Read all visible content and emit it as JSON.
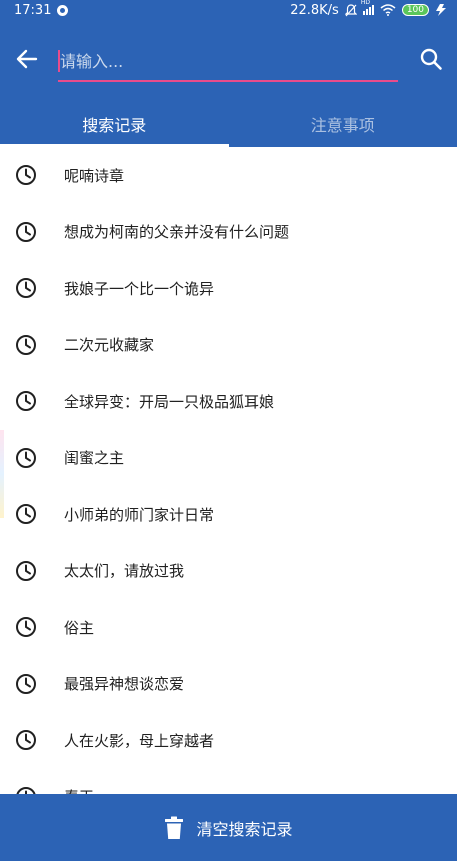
{
  "status_bar": {
    "time": "17:31",
    "network_speed": "22.8K/s",
    "hd_label": "HD",
    "battery": "100"
  },
  "search": {
    "placeholder": "请输入..."
  },
  "tabs": [
    {
      "label": "搜索记录",
      "active": true
    },
    {
      "label": "注意事项",
      "active": false
    }
  ],
  "history": [
    "呢喃诗章",
    "想成为柯南的父亲并没有什么问题",
    "我娘子一个比一个诡异",
    "二次元收藏家",
    "全球异变：开局一只极品狐耳娘",
    "闺蜜之主",
    "小师弟的师门家计日常",
    "太太们，请放过我",
    "俗主",
    "最强异神想谈恋爱",
    "人在火影，母上穿越者",
    "春天"
  ],
  "bottom_action": {
    "label": "清空搜索记录"
  },
  "colors": {
    "primary": "#2c63b5",
    "accent": "#e84c8b"
  }
}
